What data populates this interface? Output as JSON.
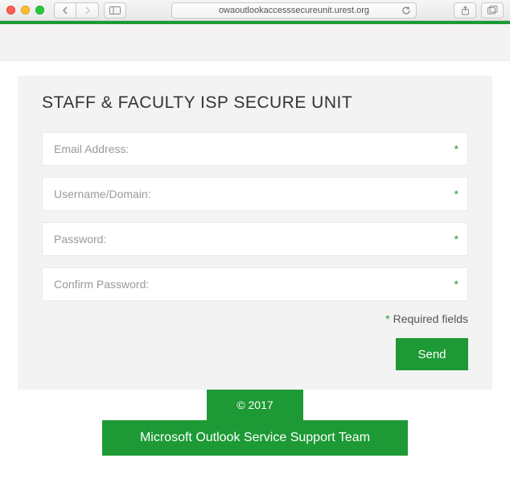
{
  "browser": {
    "url": "owaoutlookaccesssecureunit.urest.org"
  },
  "form": {
    "title": "STAFF & FACULTY ISP SECURE UNIT",
    "fields": {
      "email": {
        "placeholder": "Email Address:",
        "value": ""
      },
      "username": {
        "placeholder": "Username/Domain:",
        "value": ""
      },
      "password": {
        "placeholder": "Password:",
        "value": ""
      },
      "confirm": {
        "placeholder": "Confirm Password:",
        "value": ""
      }
    },
    "required_legend": "Required fields",
    "star": "*",
    "send_label": "Send"
  },
  "footer": {
    "copyright": "© 2017",
    "team": "Microsoft Outlook Service Support Team"
  },
  "colors": {
    "accent": "#1d9a35"
  }
}
